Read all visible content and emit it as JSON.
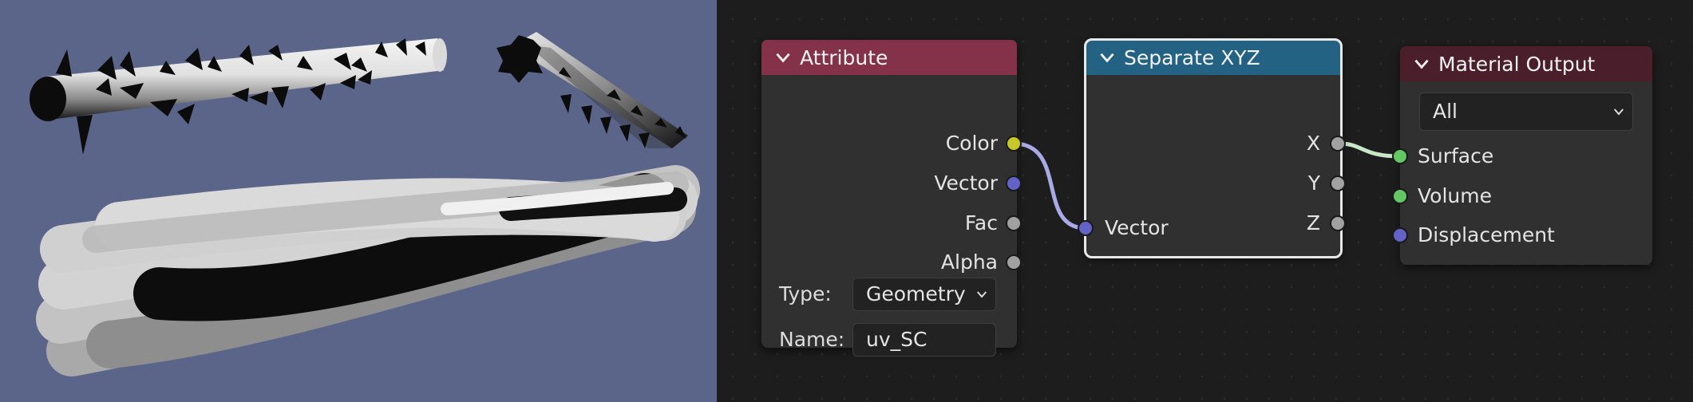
{
  "colors": {
    "viewport_bg": "#5b6589",
    "editor_bg": "#1d1d1d",
    "node_body": "#303030",
    "attribute_header": "#83324a",
    "separate_header": "#246283",
    "output_header": "#4a1f2b",
    "socket_color": "#c7c729",
    "socket_vector": "#6363c7",
    "socket_float": "#a1a1a1",
    "socket_shader": "#63c763"
  },
  "nodes": {
    "attribute": {
      "title": "Attribute",
      "outputs": {
        "color": "Color",
        "vector": "Vector",
        "fac": "Fac",
        "alpha": "Alpha"
      },
      "type_label": "Type:",
      "type_value": "Geometry",
      "name_label": "Name:",
      "name_value": "uv_SC"
    },
    "separate_xyz": {
      "title": "Separate XYZ",
      "outputs": {
        "x": "X",
        "y": "Y",
        "z": "Z"
      },
      "input_vector": "Vector"
    },
    "material_output": {
      "title": "Material Output",
      "target_value": "All",
      "inputs": {
        "surface": "Surface",
        "volume": "Volume",
        "displacement": "Displacement"
      }
    }
  },
  "icons": {
    "collapse": "chevron-down-icon",
    "dropdown": "chevron-down-icon"
  }
}
